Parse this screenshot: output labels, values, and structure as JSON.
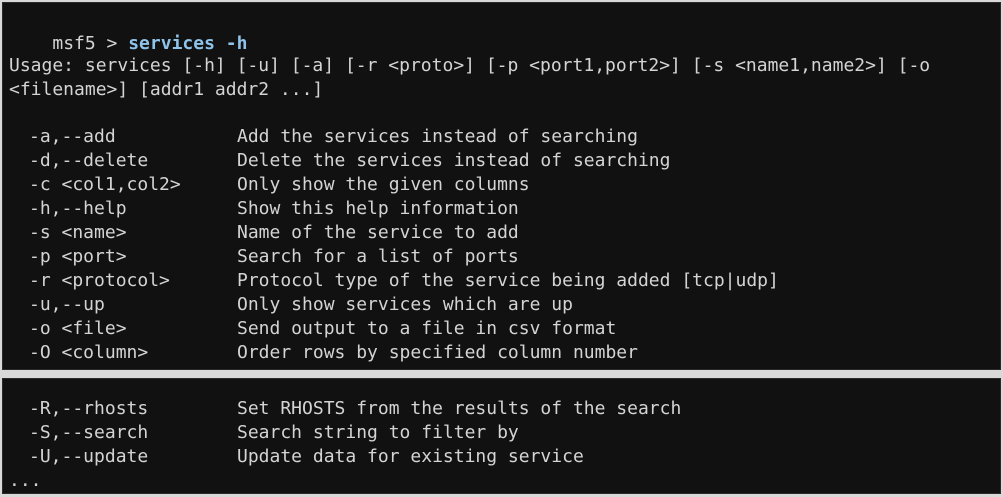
{
  "terminal": {
    "prompt": "msf5 > ",
    "command": "services -h",
    "usage_line1": "Usage: services [-h] [-u] [-a] [-r <proto>] [-p <port1,port2>] [-s <name1,name2>] [-o",
    "usage_line2": "<filename>] [addr1 addr2 ...]",
    "options": [
      {
        "flag": "-a,--add",
        "desc": "Add the services instead of searching"
      },
      {
        "flag": "-d,--delete",
        "desc": "Delete the services instead of searching"
      },
      {
        "flag": "-c <col1,col2>",
        "desc": "Only show the given columns"
      },
      {
        "flag": "-h,--help",
        "desc": "Show this help information"
      },
      {
        "flag": "-s <name>",
        "desc": "Name of the service to add"
      },
      {
        "flag": "-p <port>",
        "desc": "Search for a list of ports"
      },
      {
        "flag": "-r <protocol>",
        "desc": "Protocol type of the service being added [tcp|udp]"
      },
      {
        "flag": "-u,--up",
        "desc": "Only show services which are up"
      },
      {
        "flag": "-o <file>",
        "desc": "Send output to a file in csv format"
      },
      {
        "flag": "-O <column>",
        "desc": "Order rows by specified column number"
      }
    ],
    "options_continued": [
      {
        "flag": "-R,--rhosts",
        "desc": "Set RHOSTS from the results of the search"
      },
      {
        "flag": "-S,--search",
        "desc": "Search string to filter by"
      },
      {
        "flag": "-U,--update",
        "desc": "Update data for existing service"
      }
    ],
    "ellipsis": "..."
  },
  "colors": {
    "background": "#111111",
    "text": "#d4d4d4",
    "command": "#8ec3ea",
    "separator": "#d9d9d9"
  }
}
